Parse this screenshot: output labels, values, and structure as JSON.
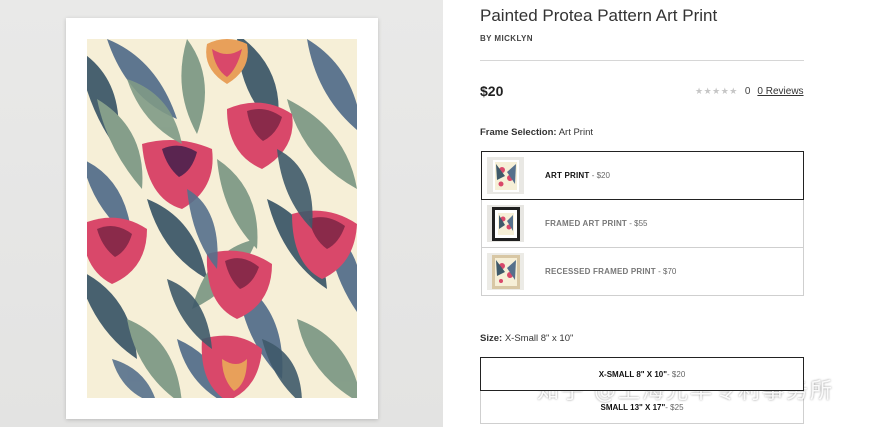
{
  "product": {
    "title": "Painted Protea Pattern Art Print",
    "byline_prefix": "BY",
    "artist": "MICKLYN",
    "price": "$20",
    "rating": {
      "stars_filled": 0,
      "stars_total": 5,
      "count": "0",
      "reviews_link": "0 Reviews"
    }
  },
  "frame_selection": {
    "label": "Frame Selection:",
    "selected_value": "Art Print",
    "options": [
      {
        "name": "ART PRINT",
        "price": " - $20",
        "selected": true
      },
      {
        "name": "FRAMED ART PRINT",
        "price": " - $55",
        "selected": false
      },
      {
        "name": "RECESSED FRAMED PRINT",
        "price": " - $70",
        "selected": false
      }
    ]
  },
  "size": {
    "label": "Size:",
    "selected_value": "X-Small 8\" x 10\"",
    "options": [
      {
        "name": "X-SMALL 8\" X 10\"",
        "price": " - $20",
        "selected": true
      },
      {
        "name": "SMALL 13\" X 17\"",
        "price": " - $25",
        "selected": false
      }
    ]
  },
  "watermark": "知乎 @上海光华专利事务所",
  "colors": {
    "preview_background": "#e6e6e5",
    "print_paper": "#ffffff",
    "art_cream": "#f6efd7",
    "leaf_dark": "#3f5a6a",
    "leaf_sage": "#7f9a86",
    "leaf_blue": "#56708c",
    "protea_pink": "#d9486a",
    "protea_deep": "#8a2a4a",
    "selected_border": "#222222",
    "default_border": "#cfcfcf"
  }
}
